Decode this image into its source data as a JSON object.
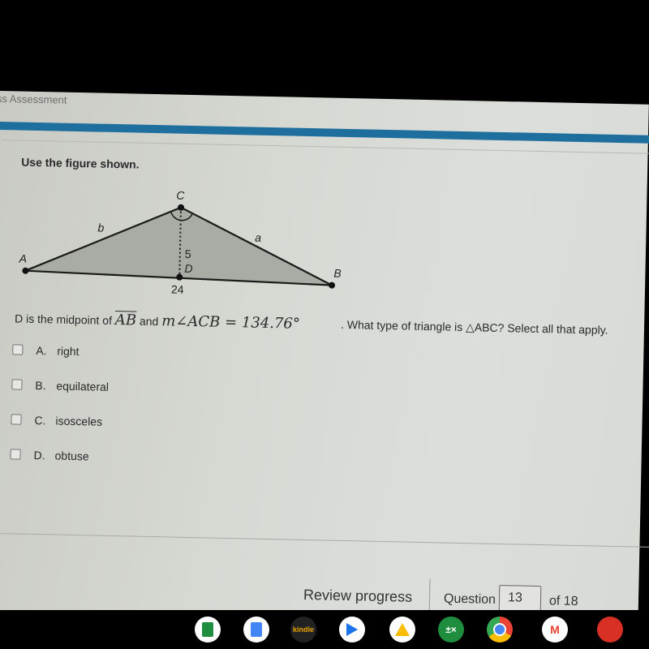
{
  "window": {
    "tab_title": "ss Assessment"
  },
  "question": {
    "prompt": "Use the figure shown.",
    "stem_prefix": "D is the midpoint of",
    "segment": "AB",
    "stem_and": "and",
    "angle_expr": "m∠ACB = 134.76°",
    "stem_suffix": ". What type of triangle is △ABC? Select all that apply."
  },
  "figure": {
    "vertices": {
      "A": "A",
      "B": "B",
      "C": "C",
      "D": "D"
    },
    "side_labels": {
      "a": "a",
      "b": "b"
    },
    "height_label": "5",
    "base_label": "24"
  },
  "choices": [
    {
      "letter": "A.",
      "text": "right",
      "checked": false
    },
    {
      "letter": "B.",
      "text": "equilateral",
      "checked": false
    },
    {
      "letter": "C.",
      "text": "isosceles",
      "checked": false
    },
    {
      "letter": "D.",
      "text": "obtuse",
      "checked": false
    }
  ],
  "footer": {
    "review_label": "Review progress",
    "question_label": "Question",
    "question_number": "13",
    "of_label": "of 18"
  },
  "dock": {
    "apps": [
      "google-sheets",
      "google-docs",
      "kindle",
      "app-arrow",
      "google-drive",
      "calculator",
      "chrome",
      "gmail",
      "app-red"
    ],
    "kindle_label": "kindle"
  }
}
